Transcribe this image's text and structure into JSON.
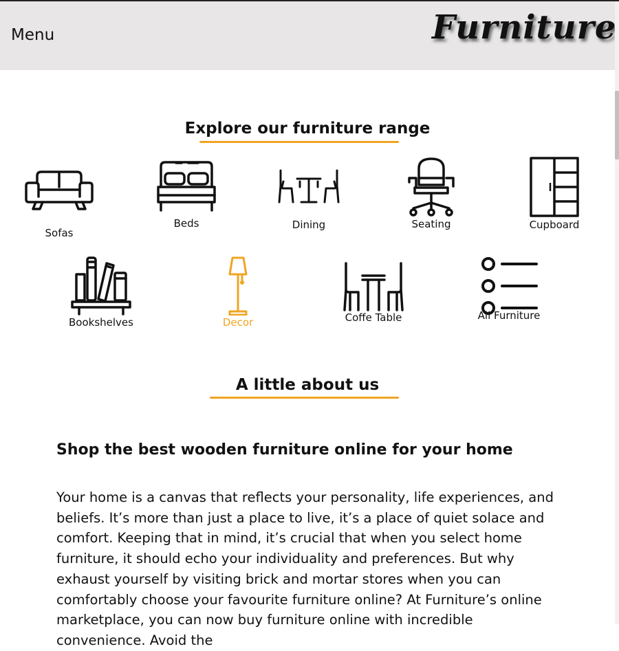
{
  "header": {
    "menu_label": "Menu",
    "brand_name": "Furniture"
  },
  "explore": {
    "title": "Explore our furniture range",
    "categories": [
      {
        "label": "Sofas",
        "icon": "sofa-icon"
      },
      {
        "label": "Beds",
        "icon": "bed-icon"
      },
      {
        "label": "Dining",
        "icon": "dining-icon"
      },
      {
        "label": "Seating",
        "icon": "office-chair-icon"
      },
      {
        "label": "Cupboard",
        "icon": "cupboard-icon"
      },
      {
        "label": "Bookshelves",
        "icon": "bookshelf-icon"
      },
      {
        "label": "Decor",
        "icon": "floor-lamp-icon"
      },
      {
        "label": "Coffe Table",
        "icon": "coffee-table-icon"
      },
      {
        "label": "All Furniture",
        "icon": "list-icon"
      }
    ]
  },
  "about": {
    "title": "A little about us",
    "heading": "Shop the best wooden furniture online for your home",
    "paragraph": "Your home is a canvas that reflects your personality, life experiences, and beliefs. It’s more than just a place to live, it’s a place of quiet solace and comfort. Keeping that in mind, it’s crucial that when you select home furniture, it should echo your individuality and preferences. But why exhaust yourself by visiting brick and mortar stores when you can comfortably choose your favourite furniture online? At Furniture’s online marketplace, you can now buy furniture online with incredible convenience. Avoid the"
  },
  "colors": {
    "accent": "#f0a422",
    "header_bg": "#e8e6e6",
    "text": "#111111"
  }
}
